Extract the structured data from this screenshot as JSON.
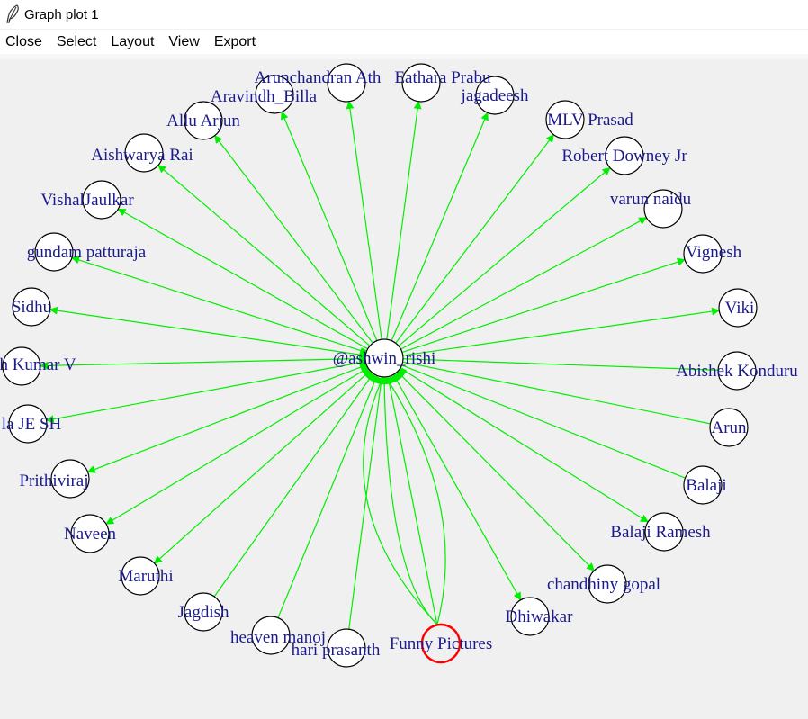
{
  "window": {
    "title": "Graph plot 1",
    "icon": "feather-icon"
  },
  "menu": {
    "items": [
      "Close",
      "Select",
      "Layout",
      "View",
      "Export"
    ]
  },
  "graph": {
    "center": "@ashwin_rishi",
    "highlighted_node": "Funny Pictures",
    "colors": {
      "edge": "#00ee00",
      "label": "#1a1a8c",
      "node_border": "#000000",
      "node_fill": "#ffffff",
      "highlight_border": "#ff0000",
      "background": "#f0f0f0"
    },
    "nodes": [
      "Arunchandran Ath",
      "Eathara Prabu",
      "jagadeesh",
      "MLV Prasad",
      "Robert Downey Jr",
      "varun naidu",
      "Vignesh",
      "Viki",
      "Abishek Konduru",
      "Arun",
      "Balaji",
      "Balaji Ramesh",
      "chandhiny gopal",
      "Dhiwakar",
      "Funny Pictures",
      "hari prasanth",
      "heaven manoj",
      "Jagdish",
      "Maruthi",
      "Naveen",
      "Prithiviraj",
      "la JE SH",
      "h Kumar V",
      "Sidhu",
      "gundam patturaja",
      "VishalJaulkar",
      "Aishwarya Rai",
      "Allu Arjun",
      "Aravindh_Billa"
    ]
  }
}
